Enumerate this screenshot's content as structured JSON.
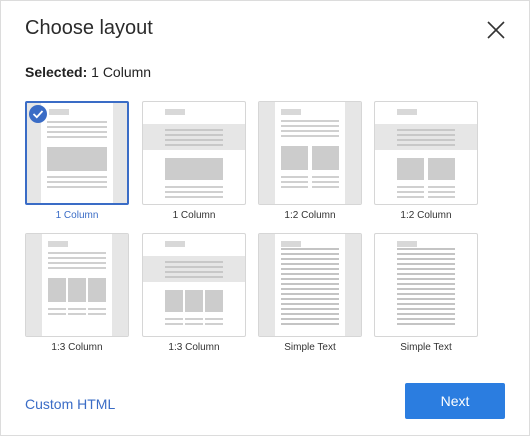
{
  "dialog": {
    "title": "Choose layout",
    "close_icon": "close-icon",
    "selected_label": "Selected:",
    "selected_value": "1 Column"
  },
  "layouts": [
    {
      "label": "1 Column",
      "selected": true
    },
    {
      "label": "1 Column",
      "selected": false
    },
    {
      "label": "1:2 Column",
      "selected": false
    },
    {
      "label": "1:2 Column",
      "selected": false
    },
    {
      "label": "1:3 Column",
      "selected": false
    },
    {
      "label": "1:3 Column",
      "selected": false
    },
    {
      "label": "Simple Text",
      "selected": false
    },
    {
      "label": "Simple Text",
      "selected": false
    }
  ],
  "footer": {
    "custom_html_link": "Custom HTML",
    "next_button": "Next"
  },
  "colors": {
    "accent": "#3a6cc6",
    "primary_button": "#2b7de0"
  }
}
